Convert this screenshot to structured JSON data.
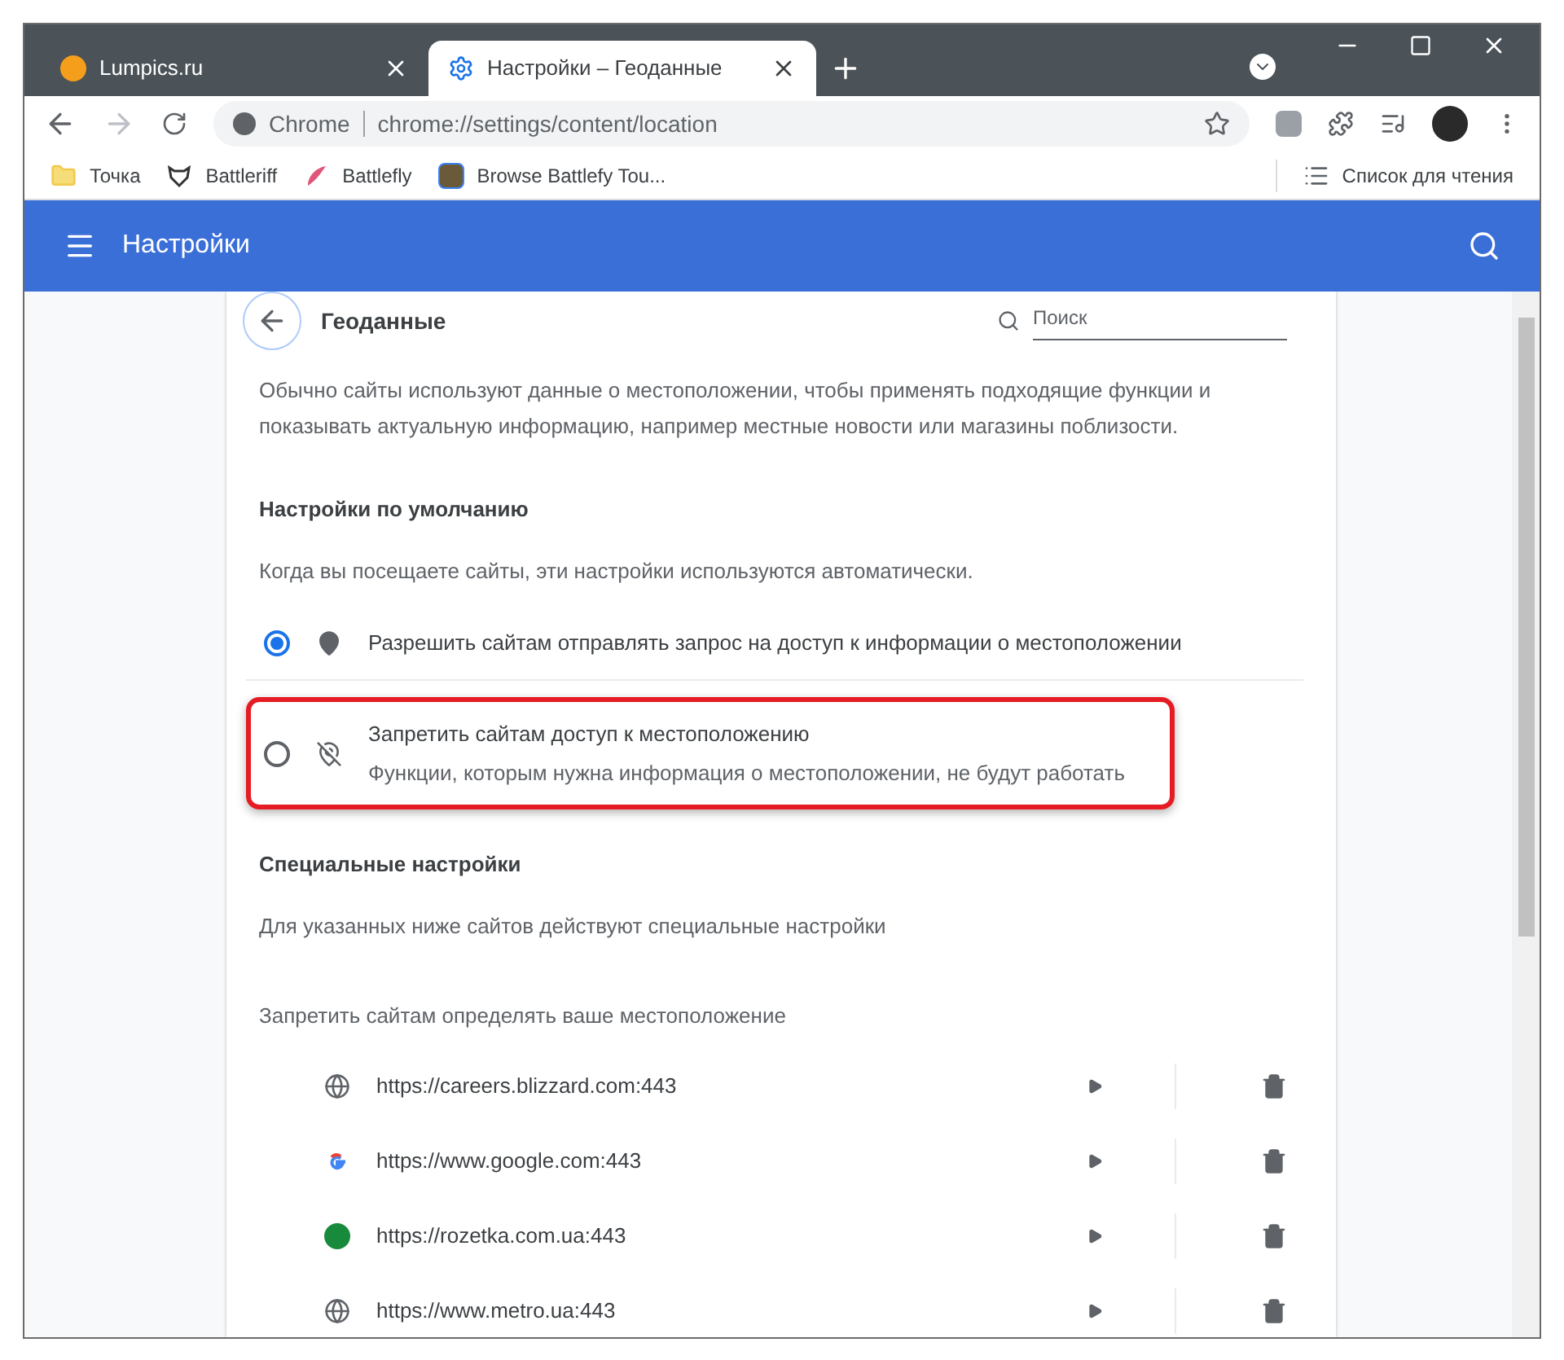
{
  "tabs": [
    {
      "title": "Lumpics.ru",
      "kind": "circle",
      "selected": false
    },
    {
      "title": "Настройки – Геоданные",
      "kind": "gear",
      "selected": true
    }
  ],
  "address_bar": {
    "site_label": "Chrome",
    "url": "chrome://settings/content/location"
  },
  "bookmarks": [
    {
      "label": "Точка",
      "kind": "folder"
    },
    {
      "label": "Battleriff",
      "kind": "mask"
    },
    {
      "label": "Battlefly",
      "kind": "wing"
    },
    {
      "label": "Browse Battlefy Tou...",
      "kind": "tile"
    }
  ],
  "reading_list": "Список для чтения",
  "header": {
    "title": "Настройки"
  },
  "page": {
    "title": "Геоданные",
    "search_placeholder": "Поиск",
    "description": "Обычно сайты используют данные о местоположении, чтобы применять подходящие функции и показывать актуальную информацию, например местные новости или магазины поблизости.",
    "default_heading": "Настройки по умолчанию",
    "default_subtitle": "Когда вы посещаете сайты, эти настройки используются автоматически.",
    "options": [
      {
        "label": "Разрешить сайтам отправлять запрос на доступ к информации о местоположении",
        "kind": "pin",
        "selected": true,
        "highlighted": false
      },
      {
        "label": "Запретить сайтам доступ к местоположению",
        "sublabel": "Функции, которым нужна информация о местоположении, не будут работать",
        "kind": "pin-off",
        "selected": false,
        "highlighted": true
      }
    ],
    "custom_heading": "Специальные настройки",
    "custom_subtitle": "Для указанных ниже сайтов действуют специальные настройки",
    "blocked_heading": "Запретить сайтам определять ваше местоположение",
    "sites": [
      {
        "url": "https://careers.blizzard.com:443",
        "kind": "globe"
      },
      {
        "url": "https://www.google.com:443",
        "kind": "google"
      },
      {
        "url": "https://rozetka.com.ua:443",
        "kind": "logo"
      },
      {
        "url": "https://www.metro.ua:443",
        "kind": "globe"
      }
    ]
  }
}
